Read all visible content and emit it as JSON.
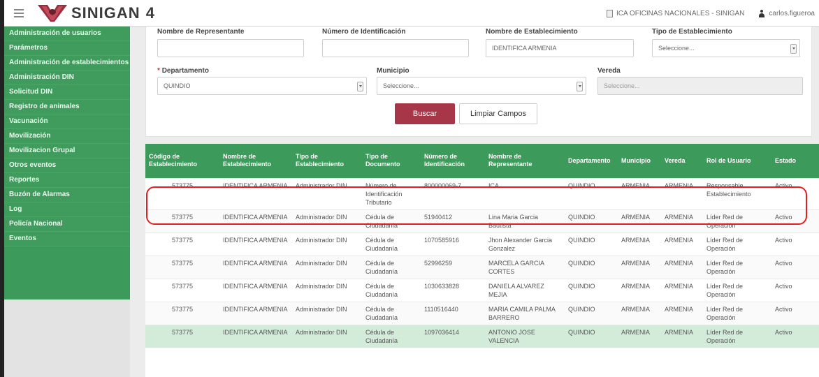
{
  "header": {
    "app_name": "SINIGAN",
    "version": "4",
    "office": "ICA OFICINAS NACIONALES - SINIGAN",
    "user": "carlos.figueroa"
  },
  "sidebar": {
    "items": [
      {
        "label": "Administración de usuarios"
      },
      {
        "label": "Parámetros"
      },
      {
        "label": "Administración de establecimientos"
      },
      {
        "label": "Administración DIN"
      },
      {
        "label": "Solicitud DIN"
      },
      {
        "label": "Registro de animales"
      },
      {
        "label": "Vacunación"
      },
      {
        "label": "Movilización"
      },
      {
        "label": "Movilizacion Grupal"
      },
      {
        "label": "Otros eventos"
      },
      {
        "label": "Reportes"
      },
      {
        "label": "Buzón de Alarmas"
      },
      {
        "label": "Log"
      },
      {
        "label": "Policía Nacional"
      },
      {
        "label": "Eventos"
      }
    ]
  },
  "form": {
    "rep_name_label": "Nombre de Representante",
    "rep_name_value": "",
    "id_number_label": "Número de Identificación",
    "id_number_value": "",
    "estab_name_label": "Nombre de Establecimiento",
    "estab_name_value": "IDENTIFICA ARMENIA",
    "estab_type_label": "Tipo de Establecimiento",
    "estab_type_value": "Seleccione...",
    "dept_required": "*",
    "dept_label": "Departamento",
    "dept_value": "QUINDIO",
    "muni_label": "Municipio",
    "muni_value": "Seleccione...",
    "vereda_label": "Vereda",
    "vereda_value": "Seleccione...",
    "search_button": "Buscar",
    "clear_button": "Limpiar Campos"
  },
  "table": {
    "columns": [
      "Código de Establecimiento",
      "Nombre de Establecimiento",
      "Tipo de Establecimiento",
      "Tipo de Documento",
      "Número de Identificación",
      "Nombre de Representante",
      "Departamento",
      "Municipio",
      "Vereda",
      "Rol de Usuario",
      "Estado"
    ],
    "rows": [
      [
        "573775",
        "IDENTIFICA ARMENIA",
        "Administrador DIN",
        "Número de Identificación Tributario",
        "800000069-7",
        "ICA",
        "QUINDIO",
        "ARMENIA",
        "ARMENIA",
        "Responsable Establecimiento",
        "Activo"
      ],
      [
        "573775",
        "IDENTIFICA ARMENIA",
        "Administrador DIN",
        "Cédula de Ciudadanía",
        "51940412",
        "Lina Maria Garcia Bautista",
        "QUINDIO",
        "ARMENIA",
        "ARMENIA",
        "Líder Red de Operación",
        "Activo"
      ],
      [
        "573775",
        "IDENTIFICA ARMENIA",
        "Administrador DIN",
        "Cédula de Ciudadanía",
        "1070585916",
        "Jhon Alexander Garcia Gonzalez",
        "QUINDIO",
        "ARMENIA",
        "ARMENIA",
        "Líder Red de Operación",
        "Activo"
      ],
      [
        "573775",
        "IDENTIFICA ARMENIA",
        "Administrador DIN",
        "Cédula de Ciudadanía",
        "52996259",
        "MARCELA GARCIA CORTES",
        "QUINDIO",
        "ARMENIA",
        "ARMENIA",
        "Líder Red de Operación",
        "Activo"
      ],
      [
        "573775",
        "IDENTIFICA ARMENIA",
        "Administrador DIN",
        "Cédula de Ciudadanía",
        "1030633828",
        "DANIELA ALVAREZ MEJIA",
        "QUINDIO",
        "ARMENIA",
        "ARMENIA",
        "Líder Red de Operación",
        "Activo"
      ],
      [
        "573775",
        "IDENTIFICA ARMENIA",
        "Administrador DIN",
        "Cédula de Ciudadanía",
        "1110516440",
        "MARIA CAMILA PALMA BARRERO",
        "QUINDIO",
        "ARMENIA",
        "ARMENIA",
        "Líder Red de Operación",
        "Activo"
      ],
      [
        "573775",
        "IDENTIFICA ARMENIA",
        "Administrador DIN",
        "Cédula de Ciudadanía",
        "1097036414",
        "ANTONIO JOSE VALENCIA",
        "QUINDIO",
        "ARMENIA",
        "ARMENIA",
        "Líder Red de Operación",
        "Activo"
      ]
    ]
  },
  "colors": {
    "sidebar_green": "#3c9a5a",
    "search_button": "#a73648",
    "highlight_outline": "#e02020",
    "selected_row": "#d3ecd9"
  }
}
